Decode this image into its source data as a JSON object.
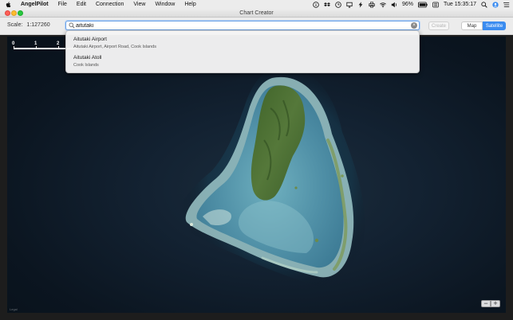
{
  "menubar": {
    "app_name": "AngelPilot",
    "items": [
      "File",
      "Edit",
      "Connection",
      "View",
      "Window",
      "Help"
    ],
    "battery": "96%",
    "clock": "Tue 15:35:17"
  },
  "window": {
    "title": "Chart Creator"
  },
  "toolbar": {
    "scale_label": "Scale:",
    "scale_value": "1:127260",
    "search_value": "aitutaki",
    "create_label": "Create",
    "map_label": "Map",
    "satellite_label": "Satellite",
    "active_view": "Satellite"
  },
  "suggestions": [
    {
      "title": "Aitutaki Airport",
      "subtitle": "Aitutaki Airport, Airport Road, Cook Islands"
    },
    {
      "title": "Aitutaki Atoll",
      "subtitle": "Cook Islands"
    }
  ],
  "map": {
    "scale_marks": [
      "0",
      "1",
      "2"
    ],
    "legal_text": "Legal",
    "zoom_out": "−",
    "zoom_in": "+"
  },
  "colors": {
    "accent": "#3b8cf0",
    "ocean": "#0b1520",
    "lagoon": "#5f9db0",
    "island_green": "#4a6b2c"
  }
}
